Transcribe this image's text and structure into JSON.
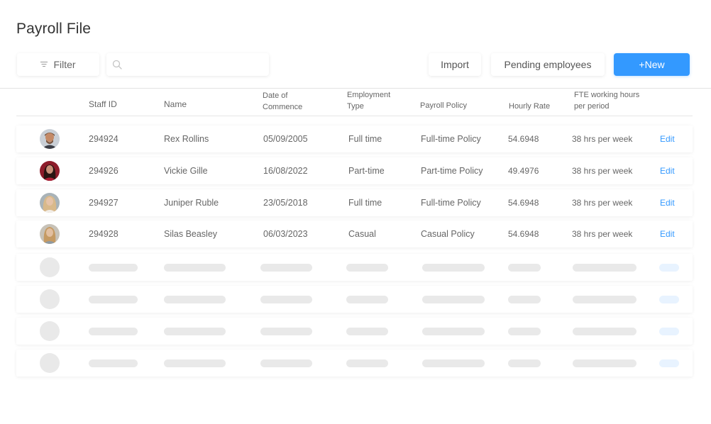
{
  "page": {
    "title": "Payroll File"
  },
  "toolbar": {
    "filter_label": "Filter",
    "search_placeholder": "",
    "import_label": "Import",
    "pending_label": "Pending employees",
    "new_label": "+New",
    "accent_color": "#3399ff"
  },
  "table": {
    "headers": {
      "staff_id": "Staff ID",
      "name": "Name",
      "date_line1": "Date of",
      "date_line2": "Commence",
      "type_line1": "Employment",
      "type_line2": "Type",
      "policy": "Payroll Policy",
      "rate": "Hourly Rate",
      "fte_line1": "FTE working hours",
      "fte_line2": "per period"
    },
    "rows": [
      {
        "staff_id": "294924",
        "name": "Rex Rollins",
        "date": "05/09/2005",
        "type": "Full time",
        "policy": "Full-time Policy",
        "rate": "54.6948",
        "fte": "38 hrs per week",
        "action": "Edit"
      },
      {
        "staff_id": "294926",
        "name": "Vickie Gille",
        "date": "16/08/2022",
        "type": "Part-time",
        "policy": "Part-time Policy",
        "rate": "49.4976",
        "fte": "38 hrs per week",
        "action": "Edit"
      },
      {
        "staff_id": "294927",
        "name": "Juniper Ruble",
        "date": "23/05/2018",
        "type": "Full time",
        "policy": "Full-time Policy",
        "rate": "54.6948",
        "fte": "38 hrs per week",
        "action": "Edit"
      },
      {
        "staff_id": "294928",
        "name": "Silas Beasley",
        "date": "06/03/2023",
        "type": "Casual",
        "policy": "Casual Policy",
        "rate": "54.6948",
        "fte": "38 hrs per week",
        "action": "Edit"
      }
    ]
  }
}
